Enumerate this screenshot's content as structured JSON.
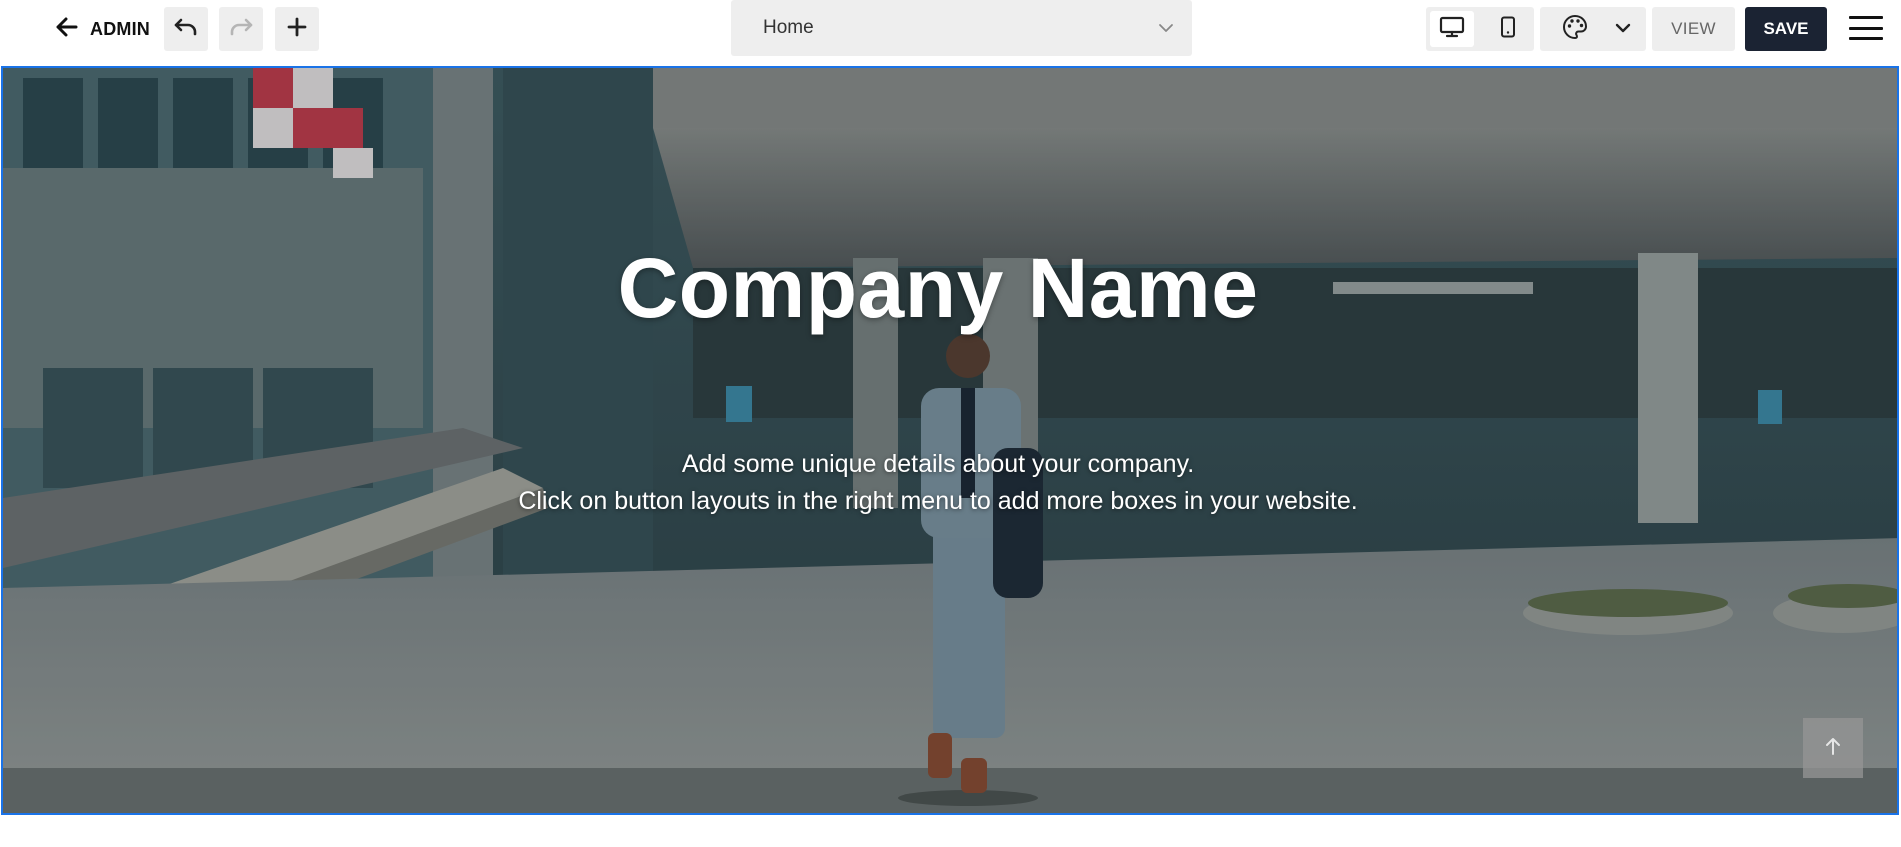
{
  "toolbar": {
    "back_label": "ADMIN",
    "page_select_value": "Home",
    "view_label": "VIEW",
    "save_label": "SAVE",
    "device_active": "desktop"
  },
  "hero": {
    "title": "Company Name",
    "subtitle_line1": "Add some unique details about your company.",
    "subtitle_line2": "Click on button layouts in the right menu to add more boxes in your website."
  },
  "colors": {
    "save_bg": "#1b2333",
    "hero_border": "#1a73e8",
    "toolbar_button_bg": "#eeeeee"
  },
  "icons": [
    "arrow-left-icon",
    "undo-icon",
    "redo-icon",
    "plus-icon",
    "chevron-down-icon",
    "desktop-icon",
    "mobile-icon",
    "palette-icon",
    "hamburger-menu-icon",
    "arrow-up-icon"
  ]
}
